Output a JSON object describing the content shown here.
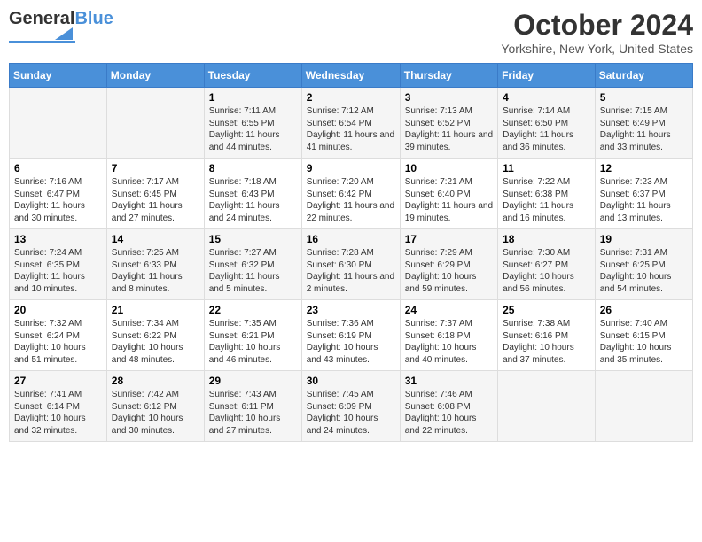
{
  "header": {
    "logo_general": "General",
    "logo_blue": "Blue",
    "month_title": "October 2024",
    "location": "Yorkshire, New York, United States"
  },
  "days_of_week": [
    "Sunday",
    "Monday",
    "Tuesday",
    "Wednesday",
    "Thursday",
    "Friday",
    "Saturday"
  ],
  "weeks": [
    [
      {
        "day": "",
        "content": ""
      },
      {
        "day": "",
        "content": ""
      },
      {
        "day": "1",
        "content": "Sunrise: 7:11 AM\nSunset: 6:55 PM\nDaylight: 11 hours and 44 minutes."
      },
      {
        "day": "2",
        "content": "Sunrise: 7:12 AM\nSunset: 6:54 PM\nDaylight: 11 hours and 41 minutes."
      },
      {
        "day": "3",
        "content": "Sunrise: 7:13 AM\nSunset: 6:52 PM\nDaylight: 11 hours and 39 minutes."
      },
      {
        "day": "4",
        "content": "Sunrise: 7:14 AM\nSunset: 6:50 PM\nDaylight: 11 hours and 36 minutes."
      },
      {
        "day": "5",
        "content": "Sunrise: 7:15 AM\nSunset: 6:49 PM\nDaylight: 11 hours and 33 minutes."
      }
    ],
    [
      {
        "day": "6",
        "content": "Sunrise: 7:16 AM\nSunset: 6:47 PM\nDaylight: 11 hours and 30 minutes."
      },
      {
        "day": "7",
        "content": "Sunrise: 7:17 AM\nSunset: 6:45 PM\nDaylight: 11 hours and 27 minutes."
      },
      {
        "day": "8",
        "content": "Sunrise: 7:18 AM\nSunset: 6:43 PM\nDaylight: 11 hours and 24 minutes."
      },
      {
        "day": "9",
        "content": "Sunrise: 7:20 AM\nSunset: 6:42 PM\nDaylight: 11 hours and 22 minutes."
      },
      {
        "day": "10",
        "content": "Sunrise: 7:21 AM\nSunset: 6:40 PM\nDaylight: 11 hours and 19 minutes."
      },
      {
        "day": "11",
        "content": "Sunrise: 7:22 AM\nSunset: 6:38 PM\nDaylight: 11 hours and 16 minutes."
      },
      {
        "day": "12",
        "content": "Sunrise: 7:23 AM\nSunset: 6:37 PM\nDaylight: 11 hours and 13 minutes."
      }
    ],
    [
      {
        "day": "13",
        "content": "Sunrise: 7:24 AM\nSunset: 6:35 PM\nDaylight: 11 hours and 10 minutes."
      },
      {
        "day": "14",
        "content": "Sunrise: 7:25 AM\nSunset: 6:33 PM\nDaylight: 11 hours and 8 minutes."
      },
      {
        "day": "15",
        "content": "Sunrise: 7:27 AM\nSunset: 6:32 PM\nDaylight: 11 hours and 5 minutes."
      },
      {
        "day": "16",
        "content": "Sunrise: 7:28 AM\nSunset: 6:30 PM\nDaylight: 11 hours and 2 minutes."
      },
      {
        "day": "17",
        "content": "Sunrise: 7:29 AM\nSunset: 6:29 PM\nDaylight: 10 hours and 59 minutes."
      },
      {
        "day": "18",
        "content": "Sunrise: 7:30 AM\nSunset: 6:27 PM\nDaylight: 10 hours and 56 minutes."
      },
      {
        "day": "19",
        "content": "Sunrise: 7:31 AM\nSunset: 6:25 PM\nDaylight: 10 hours and 54 minutes."
      }
    ],
    [
      {
        "day": "20",
        "content": "Sunrise: 7:32 AM\nSunset: 6:24 PM\nDaylight: 10 hours and 51 minutes."
      },
      {
        "day": "21",
        "content": "Sunrise: 7:34 AM\nSunset: 6:22 PM\nDaylight: 10 hours and 48 minutes."
      },
      {
        "day": "22",
        "content": "Sunrise: 7:35 AM\nSunset: 6:21 PM\nDaylight: 10 hours and 46 minutes."
      },
      {
        "day": "23",
        "content": "Sunrise: 7:36 AM\nSunset: 6:19 PM\nDaylight: 10 hours and 43 minutes."
      },
      {
        "day": "24",
        "content": "Sunrise: 7:37 AM\nSunset: 6:18 PM\nDaylight: 10 hours and 40 minutes."
      },
      {
        "day": "25",
        "content": "Sunrise: 7:38 AM\nSunset: 6:16 PM\nDaylight: 10 hours and 37 minutes."
      },
      {
        "day": "26",
        "content": "Sunrise: 7:40 AM\nSunset: 6:15 PM\nDaylight: 10 hours and 35 minutes."
      }
    ],
    [
      {
        "day": "27",
        "content": "Sunrise: 7:41 AM\nSunset: 6:14 PM\nDaylight: 10 hours and 32 minutes."
      },
      {
        "day": "28",
        "content": "Sunrise: 7:42 AM\nSunset: 6:12 PM\nDaylight: 10 hours and 30 minutes."
      },
      {
        "day": "29",
        "content": "Sunrise: 7:43 AM\nSunset: 6:11 PM\nDaylight: 10 hours and 27 minutes."
      },
      {
        "day": "30",
        "content": "Sunrise: 7:45 AM\nSunset: 6:09 PM\nDaylight: 10 hours and 24 minutes."
      },
      {
        "day": "31",
        "content": "Sunrise: 7:46 AM\nSunset: 6:08 PM\nDaylight: 10 hours and 22 minutes."
      },
      {
        "day": "",
        "content": ""
      },
      {
        "day": "",
        "content": ""
      }
    ]
  ]
}
